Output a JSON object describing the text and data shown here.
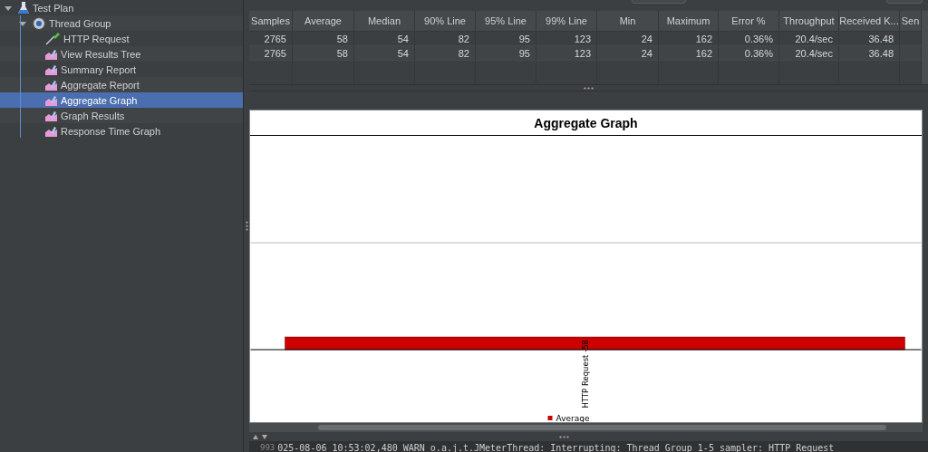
{
  "tree": [
    {
      "label": "Test Plan",
      "kind": "plan",
      "selected": false,
      "expanded": true,
      "children": [
        {
          "label": "Thread Group",
          "kind": "threads",
          "selected": false,
          "expanded": true,
          "children": [
            {
              "label": "HTTP Request",
              "kind": "sampler",
              "selected": false
            },
            {
              "label": "View Results Tree",
              "kind": "listener",
              "selected": false
            },
            {
              "label": "Summary Report",
              "kind": "listener",
              "selected": false
            },
            {
              "label": "Aggregate Report",
              "kind": "listener",
              "selected": false
            },
            {
              "label": "Aggregate Graph",
              "kind": "listener",
              "selected": true
            },
            {
              "label": "Graph Results",
              "kind": "listener",
              "selected": false
            },
            {
              "label": "Response Time Graph",
              "kind": "listener",
              "selected": false
            }
          ]
        }
      ]
    }
  ],
  "table": {
    "columns": [
      "Samples",
      "Average",
      "Median",
      "90% Line",
      "95% Line",
      "99% Line",
      "Min",
      "Maximum",
      "Error %",
      "Throughput",
      "Received K...",
      "Sen"
    ],
    "rows": [
      [
        "2765",
        "58",
        "54",
        "82",
        "95",
        "123",
        "24",
        "162",
        "0.36%",
        "20.4/sec",
        "36.48"
      ],
      [
        "2765",
        "58",
        "54",
        "82",
        "95",
        "123",
        "24",
        "162",
        "0.36%",
        "20.4/sec",
        "36.48"
      ]
    ]
  },
  "graph": {
    "title": "Aggregate Graph",
    "bar_label": "HTTP Request -58",
    "legend": "Average"
  },
  "log": {
    "line_number": "993",
    "text": "025-08-06 10:53:02,480 WARN o.a.j.t.JMeterThread: Interrupting: Thread Group 1-5 sampler: HTTP Request"
  }
}
